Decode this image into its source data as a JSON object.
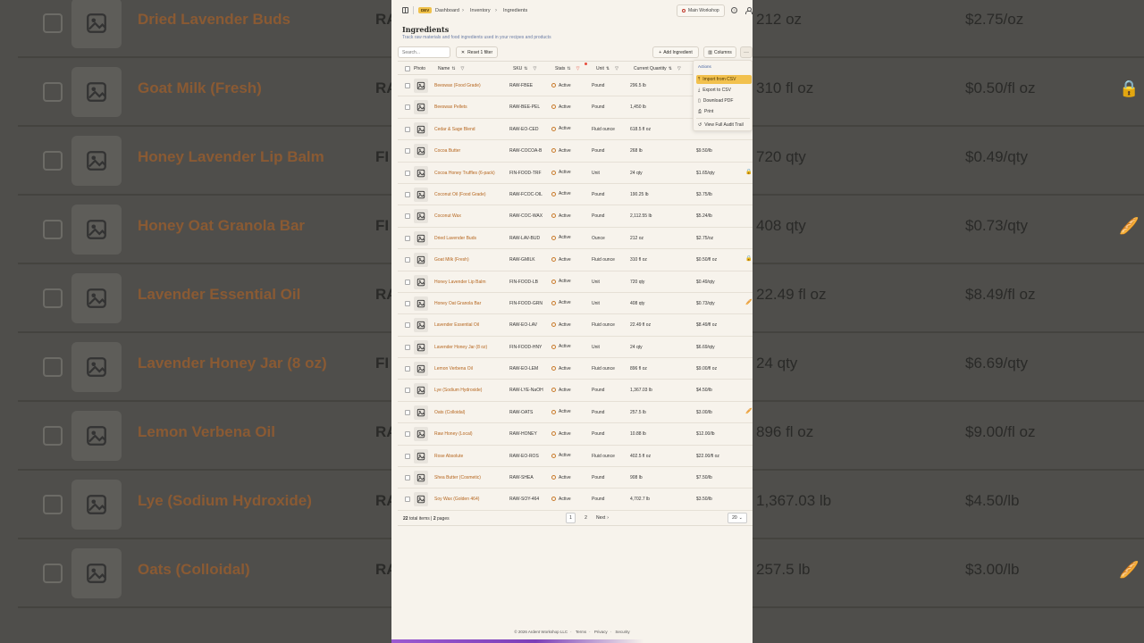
{
  "background_rows": [
    {
      "name": "Dried Lavender Buds",
      "sku": "RA",
      "qty": "212 oz",
      "cost": "$2.75/oz",
      "flag": ""
    },
    {
      "name": "Goat Milk (Fresh)",
      "sku": "RA",
      "qty": "310 fl oz",
      "cost": "$0.50/fl oz",
      "flag": "🔒"
    },
    {
      "name": "Honey Lavender Lip Balm",
      "sku": "FI",
      "qty": "720 qty",
      "cost": "$0.49/qty",
      "flag": ""
    },
    {
      "name": "Honey Oat Granola Bar",
      "sku": "FI",
      "qty": "408 qty",
      "cost": "$0.73/qty",
      "flag": "🥖"
    },
    {
      "name": "Lavender Essential Oil",
      "sku": "RA",
      "qty": "22.49 fl oz",
      "cost": "$8.49/fl oz",
      "flag": ""
    },
    {
      "name": "Lavender Honey Jar (8 oz)",
      "sku": "FI",
      "qty": "24 qty",
      "cost": "$6.69/qty",
      "flag": ""
    },
    {
      "name": "Lemon Verbena Oil",
      "sku": "RA",
      "qty": "896 fl oz",
      "cost": "$9.00/fl oz",
      "flag": ""
    },
    {
      "name": "Lye (Sodium Hydroxide)",
      "sku": "RA",
      "qty": "1,367.03 lb",
      "cost": "$4.50/lb",
      "flag": ""
    },
    {
      "name": "Oats (Colloidal)",
      "sku": "RA",
      "qty": "257.5 lb",
      "cost": "$3.00/lb",
      "flag": "🥖"
    }
  ],
  "topbar": {
    "dev_badge": "DEV",
    "crumbs": [
      "Dashboard",
      "Inventory",
      "Ingredients"
    ],
    "location": "Main Workshop"
  },
  "page": {
    "title": "Ingredients",
    "subtitle": "Track raw materials and food ingredients used in your recipes and products"
  },
  "toolbar": {
    "search_placeholder": "Search...",
    "reset_label": "Reset 1 filter",
    "add_label": "Add Ingredient",
    "columns_label": "Columns",
    "more_label": "···"
  },
  "columns": {
    "photo": "Photo",
    "name": "Name",
    "sku": "SKU",
    "status": "Stats",
    "unit": "Unit",
    "qty": "Current Quantity"
  },
  "rows": [
    {
      "name": "Beeswax (Food Grade)",
      "sku": "RAW-FBEE",
      "status": "Active",
      "unit": "Pound",
      "qty": "296.5 lb",
      "cost": "",
      "flag": ""
    },
    {
      "name": "Beeswax Pellets",
      "sku": "RAW-BEE-PEL",
      "status": "Active",
      "unit": "Pound",
      "qty": "1,450 lb",
      "cost": "",
      "flag": ""
    },
    {
      "name": "Cedar & Sage Blend",
      "sku": "RAW-EO-CED",
      "status": "Active",
      "unit": "Fluid ounce",
      "qty": "618.5 fl oz",
      "cost": "",
      "flag": ""
    },
    {
      "name": "Cocoa Butter",
      "sku": "RAW-COCOA-B",
      "status": "Active",
      "unit": "Pound",
      "qty": "268 lb",
      "cost": "$9.50/lb",
      "flag": ""
    },
    {
      "name": "Cocoa Honey Truffles (6-pack)",
      "sku": "FIN-FOOD-TRF",
      "status": "Active",
      "unit": "Unit",
      "qty": "24 qty",
      "cost": "$1.65/qty",
      "flag": "🔒"
    },
    {
      "name": "Coconut Oil (Food Grade)",
      "sku": "RAW-FCOC-OIL",
      "status": "Active",
      "unit": "Pound",
      "qty": "190.25 lb",
      "cost": "$3.75/lb",
      "flag": ""
    },
    {
      "name": "Coconut Wax",
      "sku": "RAW-COC-WAX",
      "status": "Active",
      "unit": "Pound",
      "qty": "2,112.55 lb",
      "cost": "$5.24/lb",
      "flag": ""
    },
    {
      "name": "Dried Lavender Buds",
      "sku": "RAW-LAV-BUD",
      "status": "Active",
      "unit": "Ounce",
      "qty": "212 oz",
      "cost": "$2.75/oz",
      "flag": ""
    },
    {
      "name": "Goat Milk (Fresh)",
      "sku": "RAW-GMILK",
      "status": "Active",
      "unit": "Fluid ounce",
      "qty": "310 fl oz",
      "cost": "$0.50/fl oz",
      "flag": "🔒"
    },
    {
      "name": "Honey Lavender Lip Balm",
      "sku": "FIN-FOOD-LB",
      "status": "Active",
      "unit": "Unit",
      "qty": "720 qty",
      "cost": "$0.49/qty",
      "flag": ""
    },
    {
      "name": "Honey Oat Granola Bar",
      "sku": "FIN-FOOD-GRN",
      "status": "Active",
      "unit": "Unit",
      "qty": "408 qty",
      "cost": "$0.73/qty",
      "flag": "🥖"
    },
    {
      "name": "Lavender Essential Oil",
      "sku": "RAW-EO-LAV",
      "status": "Active",
      "unit": "Fluid ounce",
      "qty": "22.49 fl oz",
      "cost": "$8.49/fl oz",
      "flag": ""
    },
    {
      "name": "Lavender Honey Jar (8 oz)",
      "sku": "FIN-FOOD-HNY",
      "status": "Active",
      "unit": "Unit",
      "qty": "24 qty",
      "cost": "$6.69/qty",
      "flag": ""
    },
    {
      "name": "Lemon Verbena Oil",
      "sku": "RAW-EO-LEM",
      "status": "Active",
      "unit": "Fluid ounce",
      "qty": "896 fl oz",
      "cost": "$9.00/fl oz",
      "flag": ""
    },
    {
      "name": "Lye (Sodium Hydroxide)",
      "sku": "RAW-LYE-NaOH",
      "status": "Active",
      "unit": "Pound",
      "qty": "1,367.03 lb",
      "cost": "$4.50/lb",
      "flag": ""
    },
    {
      "name": "Oats (Colloidal)",
      "sku": "RAW-OATS",
      "status": "Active",
      "unit": "Pound",
      "qty": "257.5 lb",
      "cost": "$3.00/lb",
      "flag": "🥖"
    },
    {
      "name": "Raw Honey (Local)",
      "sku": "RAW-HONEY",
      "status": "Active",
      "unit": "Pound",
      "qty": "10.88 lb",
      "cost": "$12.00/lb",
      "flag": ""
    },
    {
      "name": "Rose Absolute",
      "sku": "RAW-EO-ROS",
      "status": "Active",
      "unit": "Fluid ounce",
      "qty": "402.5 fl oz",
      "cost": "$22.00/fl oz",
      "flag": ""
    },
    {
      "name": "Shea Butter (Cosmetic)",
      "sku": "RAW-SHEA",
      "status": "Active",
      "unit": "Pound",
      "qty": "908 lb",
      "cost": "$7.50/lb",
      "flag": ""
    },
    {
      "name": "Soy Wax (Golden 464)",
      "sku": "RAW-SOY-464",
      "status": "Active",
      "unit": "Pound",
      "qty": "4,702.7 lb",
      "cost": "$3.50/lb",
      "flag": ""
    }
  ],
  "pagination": {
    "total_count": "22",
    "total_label": "total items",
    "pages_count": "2",
    "pages_label": "pages",
    "page1": "1",
    "page2": "2",
    "next": "Next",
    "per_page": "20"
  },
  "menu": {
    "heading": "Actions",
    "items": [
      "Import from CSV",
      "Export to CSV",
      "Download PDF",
      "Print",
      "View Full Audit Trail"
    ]
  },
  "legal": {
    "copyright": "© 2026 Ardent Workshop LLC",
    "terms": "Terms",
    "privacy": "Privacy",
    "security": "Security"
  },
  "colors": {
    "accent": "#b5651d",
    "highlight": "#f2c14e",
    "dev_badge": "#f0c14a"
  }
}
